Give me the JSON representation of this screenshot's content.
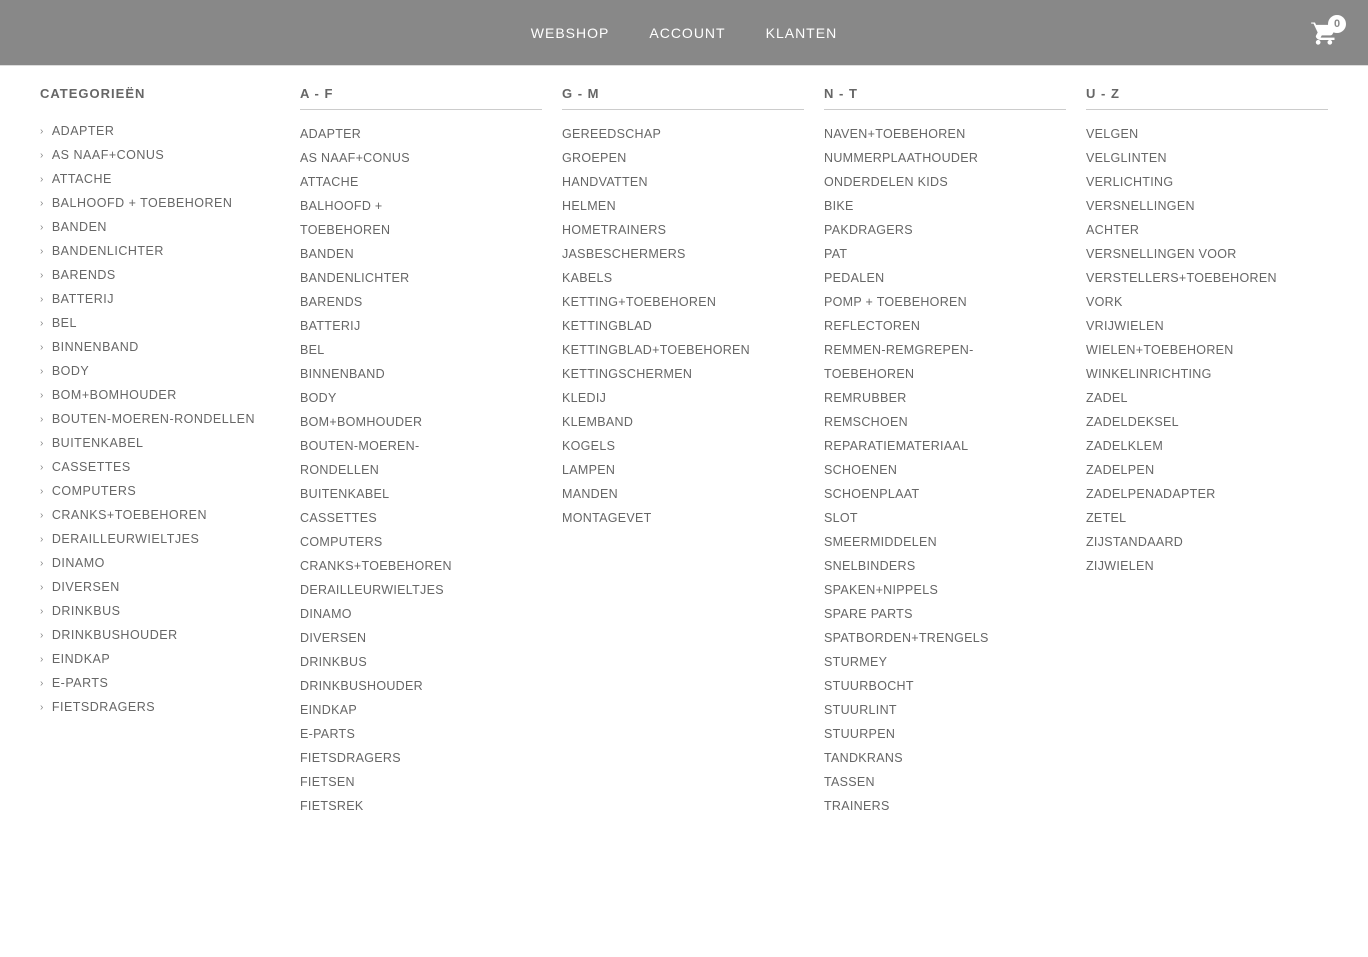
{
  "header": {
    "nav": [
      {
        "label": "WEBSHOP",
        "id": "webshop"
      },
      {
        "label": "ACCOUNT",
        "id": "account"
      },
      {
        "label": "KLANTEN",
        "id": "klanten"
      }
    ],
    "cart_count": "0"
  },
  "sidebar": {
    "title": "CATEGORIEËN",
    "items": [
      "ADAPTER",
      "AS NAAF+CONUS",
      "ATTACHE",
      "BALHOOFD + TOEBEHOREN",
      "BANDEN",
      "BANDENLICHTER",
      "BARENDS",
      "BATTERIJ",
      "BEL",
      "BINNENBAND",
      "BODY",
      "BOM+BOMHOUDER",
      "BOUTEN-MOEREN-RONDELLEN",
      "BUITENKABEL",
      "CASSETTES",
      "COMPUTERS",
      "CRANKS+TOEBEHOREN",
      "DERAILLEURWIELTJES",
      "DINAMO",
      "DIVERSEN",
      "DRINKBUS",
      "DRINKBUSHOUDER",
      "EINDKAP",
      "E-PARTS",
      "FIETSDRAGERS"
    ]
  },
  "columns": {
    "af": {
      "header": "A - F",
      "items": [
        "ADAPTER",
        "AS NAAF+CONUS",
        "ATTACHE",
        "BALHOOFD +",
        "TOEBEHOREN",
        "BANDEN",
        "BANDENLICHTER",
        "BARENDS",
        "BATTERIJ",
        "BEL",
        "BINNENBAND",
        "BODY",
        "BOM+BOMHOUDER",
        "BOUTEN-MOEREN-",
        "RONDELLEN",
        "BUITENKABEL",
        "CASSETTES",
        "COMPUTERS",
        "CRANKS+TOEBEHOREN",
        "DERAILLEURWIELTJES",
        "DINAMO",
        "DIVERSEN",
        "DRINKBUS",
        "DRINKBUSHOUDER",
        "EINDKAP",
        "E-PARTS",
        "FIETSDRAGERS",
        "FIETSEN",
        "FIETSREK"
      ]
    },
    "gm": {
      "header": "G - M",
      "items": [
        "GEREEDSCHAP",
        "GROEPEN",
        "HANDVATTEN",
        "HELMEN",
        "HOMETRAINERS",
        "JASBESCHERMERS",
        "KABELS",
        "KETTING+TOEBEHOREN",
        "KETTINGBLAD",
        "KETTINGBLAD+TOEBEHOREN",
        "KETTINGSCHERMEN",
        "KLEDIJ",
        "KLEMBAND",
        "KOGELS",
        "LAMPEN",
        "MANDEN",
        "MONTAGEVET"
      ]
    },
    "nt": {
      "header": "N - T",
      "items": [
        "NAVEN+TOEBEHOREN",
        "NUMMERPLAATHOUDER",
        "ONDERDELEN KIDS",
        "BIKE",
        "PAKDRAGERS",
        "PAT",
        "PEDALEN",
        "POMP + TOEBEHOREN",
        "REFLECTOREN",
        "REMMEN-REMGREPEN-",
        "TOEBEHOREN",
        "REMRUBBER",
        "REMSCHOEN",
        "REPARATIEMATERIAAL",
        "SCHOENEN",
        "SCHOENPLAAT",
        "SLOT",
        "SMEERMIDDELEN",
        "SNELBINDERS",
        "SPAKEN+NIPPELS",
        "SPARE PARTS",
        "SPATBORDEN+TRENGELS",
        "STURMEY",
        "STUURBOCHT",
        "STUURLINT",
        "STUURPEN",
        "TANDKRANS",
        "TASSEN",
        "TRAINERS"
      ]
    },
    "uz": {
      "header": "U - Z",
      "items": [
        "VELGEN",
        "VELGLINTEN",
        "VERLICHTING",
        "VERSNELLINGEN",
        "ACHTER",
        "VERSNELLINGEN VOOR",
        "VERSTELLERS+TOEBEHOREN",
        "VORK",
        "VRIJWIELEN",
        "WIELEN+TOEBEHOREN",
        "WINKELINRICHTING",
        "ZADEL",
        "ZADELDEKSEL",
        "ZADELKLEM",
        "ZADELPEN",
        "ZADELPENADAPTER",
        "ZETEL",
        "ZIJSTANDAARD",
        "ZIJWIELEN"
      ]
    }
  }
}
